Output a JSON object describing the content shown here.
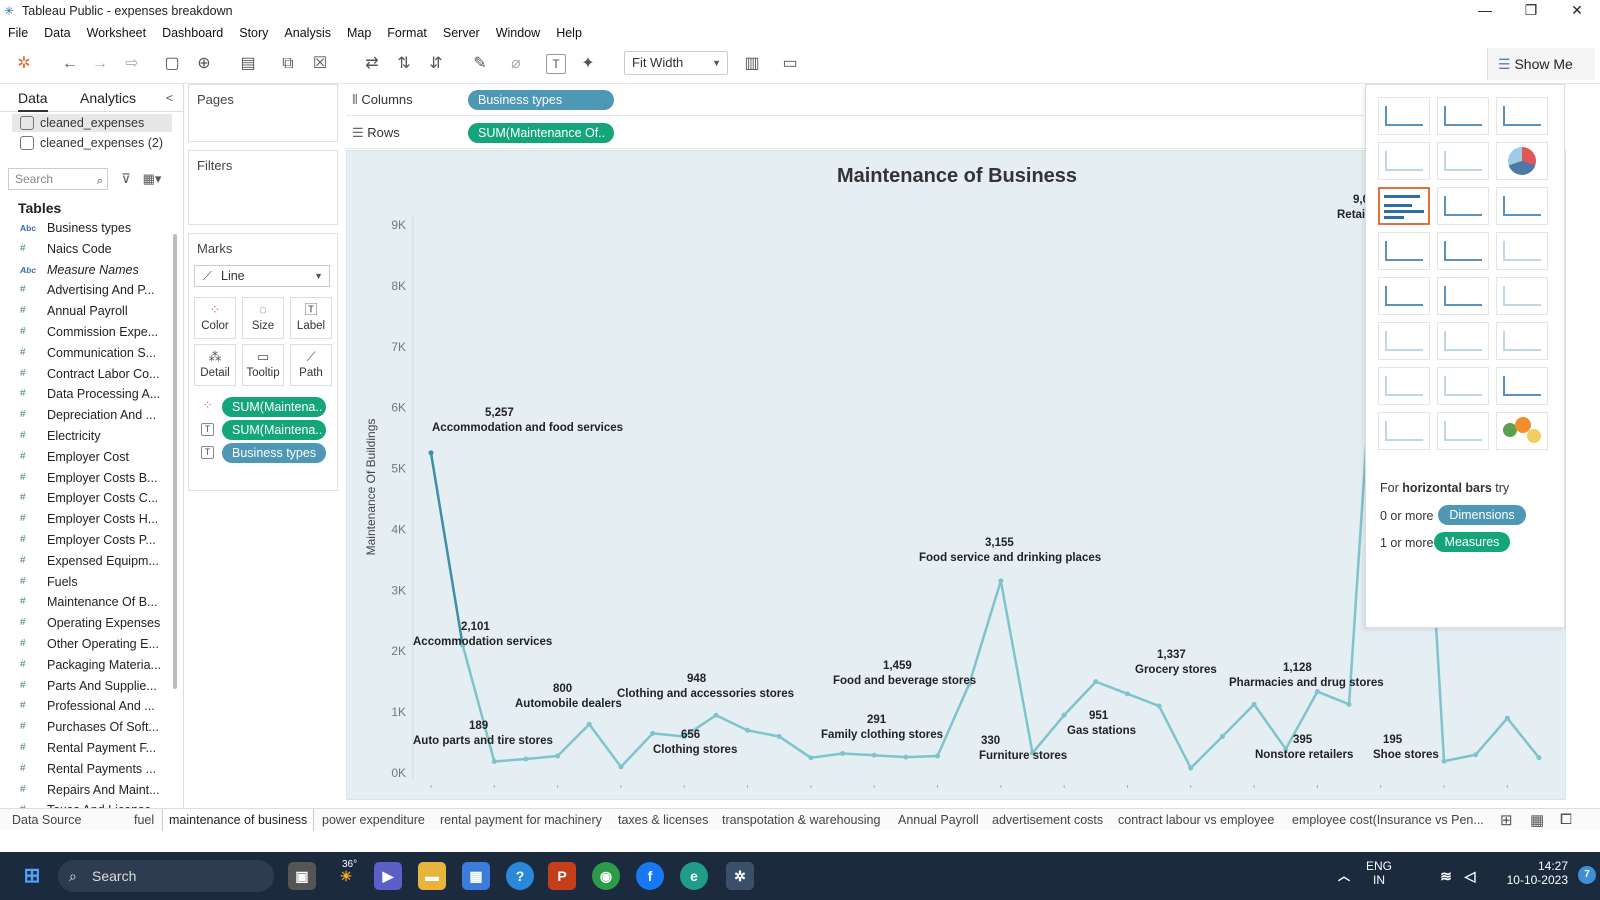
{
  "window": {
    "title": "Tableau Public - expenses breakdown"
  },
  "menu": [
    "File",
    "Data",
    "Worksheet",
    "Dashboard",
    "Story",
    "Analysis",
    "Map",
    "Format",
    "Server",
    "Window",
    "Help"
  ],
  "toolbar": {
    "fit": "Fit Width",
    "show_me": "Show Me"
  },
  "data_pane": {
    "tabs": [
      "Data",
      "Analytics"
    ],
    "datasources": [
      "cleaned_expenses",
      "cleaned_expenses (2)"
    ],
    "search_placeholder": "Search",
    "tables_header": "Tables",
    "fields": [
      {
        "type": "Abc",
        "name": "Business types"
      },
      {
        "type": "#",
        "name": "Naics Code"
      },
      {
        "type": "Abc",
        "name": "Measure Names"
      },
      {
        "type": "#",
        "name": "Advertising And P..."
      },
      {
        "type": "#",
        "name": "Annual Payroll"
      },
      {
        "type": "#",
        "name": "Commission Expe..."
      },
      {
        "type": "#",
        "name": "Communication S..."
      },
      {
        "type": "#",
        "name": "Contract Labor Co..."
      },
      {
        "type": "#",
        "name": "Data Processing A..."
      },
      {
        "type": "#",
        "name": "Depreciation And ..."
      },
      {
        "type": "#",
        "name": "Electricity"
      },
      {
        "type": "#",
        "name": "Employer Cost"
      },
      {
        "type": "#",
        "name": "Employer Costs B..."
      },
      {
        "type": "#",
        "name": "Employer Costs C..."
      },
      {
        "type": "#",
        "name": "Employer Costs H..."
      },
      {
        "type": "#",
        "name": "Employer Costs P..."
      },
      {
        "type": "#",
        "name": "Expensed Equipm..."
      },
      {
        "type": "#",
        "name": "Fuels"
      },
      {
        "type": "#",
        "name": "Maintenance Of B..."
      },
      {
        "type": "#",
        "name": "Operating Expenses"
      },
      {
        "type": "#",
        "name": "Other Operating E..."
      },
      {
        "type": "#",
        "name": "Packaging Materia..."
      },
      {
        "type": "#",
        "name": "Parts And Supplie..."
      },
      {
        "type": "#",
        "name": "Professional And ..."
      },
      {
        "type": "#",
        "name": "Purchases Of Soft..."
      },
      {
        "type": "#",
        "name": "Rental Payment F..."
      },
      {
        "type": "#",
        "name": "Rental Payments ..."
      },
      {
        "type": "#",
        "name": "Repairs And Maint..."
      },
      {
        "type": "#",
        "name": "Taxes And License..."
      }
    ]
  },
  "cards": {
    "pages": "Pages",
    "filters": "Filters",
    "marks": "Marks",
    "mark_type": "Line",
    "mark_buttons": [
      "Color",
      "Size",
      "Label",
      "Detail",
      "Tooltip",
      "Path"
    ],
    "mark_pills": [
      "SUM(Maintena..",
      "SUM(Maintena..",
      "Business types"
    ]
  },
  "shelves": {
    "columns_label": "Columns",
    "rows_label": "Rows",
    "columns_pill": "Business types",
    "rows_pill": "SUM(Maintenance Of.."
  },
  "chart_data": {
    "type": "line",
    "title": "Maintenance of Business",
    "ylabel": "Maintenance Of Buildings",
    "ylim": [
      0,
      9000
    ],
    "yticks": [
      "0K",
      "1K",
      "2K",
      "3K",
      "4K",
      "5K",
      "6K",
      "7K",
      "8K",
      "9K"
    ],
    "values": [
      5257,
      2101,
      189,
      230,
      280,
      800,
      100,
      650,
      600,
      948,
      700,
      600,
      250,
      320,
      291,
      260,
      280,
      1459,
      3155,
      330,
      950,
      1500,
      1300,
      1100,
      80,
      600,
      1128,
      395,
      1337,
      1128,
      9000,
      9000,
      195,
      300,
      900,
      250
    ],
    "labels": [
      {
        "i": 0,
        "value": "5,257",
        "name": "Accommodation and food services"
      },
      {
        "i": 1,
        "value": "2,101",
        "name": "Accommodation services"
      },
      {
        "i": 2,
        "value": "189",
        "name": "Auto parts and tire stores"
      },
      {
        "i": 5,
        "value": "800",
        "name": "Automobile dealers"
      },
      {
        "i": 9,
        "value": "948",
        "name": "Clothing and accessories stores"
      },
      {
        "i": 8,
        "value": "656",
        "name": "Clothing stores"
      },
      {
        "i": 14,
        "value": "291",
        "name": "Family clothing stores"
      },
      {
        "i": 17,
        "value": "1,459",
        "name": "Food and beverage stores"
      },
      {
        "i": 18,
        "value": "3,155",
        "name": "Food service and drinking places"
      },
      {
        "i": 19,
        "value": "330",
        "name": "Furniture stores"
      },
      {
        "i": 20,
        "value": "951",
        "name": "Gas stations"
      },
      {
        "i": 22,
        "value": "1,337",
        "name": "Grocery stores"
      },
      {
        "i": 27,
        "value": "395",
        "name": "Nonstore retailers"
      },
      {
        "i": 26,
        "value": "1,128",
        "name": "Pharmacies and drug stores"
      },
      {
        "i": 32,
        "value": "195",
        "name": "Shoe stores"
      },
      {
        "i": 30,
        "value": "9,0",
        "name": "Retail"
      }
    ]
  },
  "show_me": {
    "hint_prefix": "For ",
    "hint_bold": "horizontal bars",
    "hint_suffix": " try",
    "dims_prefix": "0 or more",
    "dims": "Dimensions",
    "meas_prefix": "1 or more",
    "meas": "Measures"
  },
  "sheet_tabs": [
    "Data Source",
    "fuel",
    "maintenance of business",
    "power expenditure",
    "rental payment for machinery",
    "taxes & licenses",
    "transpotation & warehousing",
    "Annual Payroll",
    "advertisement costs",
    "contract labour vs employee",
    "employee cost(Insurance vs Pen..."
  ],
  "taskbar": {
    "search": "Search",
    "weather": "36°",
    "lang1": "ENG",
    "lang2": "IN",
    "time": "14:27",
    "date": "10-10-2023",
    "notif": "7"
  },
  "colors": {
    "line": "#7fc4cc",
    "line_dark": "#3d8fa8",
    "dim_pill": "#4e97b5",
    "measure_pill": "#15a57a",
    "viz_bg": "#e4eef3",
    "taskbar": "#1c2a3e"
  }
}
